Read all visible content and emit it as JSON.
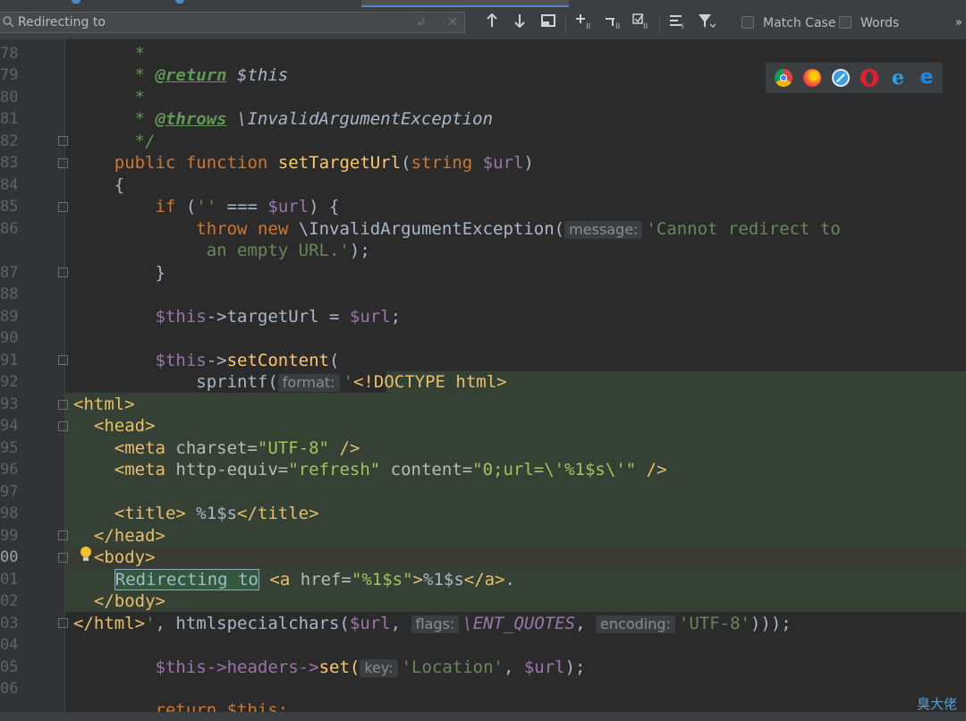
{
  "search": {
    "value": "Redirecting to",
    "match_case_label": "Match Case",
    "words_label": "Words"
  },
  "toolbar_icons": [
    "arrow-up-icon",
    "arrow-down-icon",
    "select-all-occurrences-icon",
    "add-occurrence-icon",
    "remove-occurrence-icon",
    "select-all-icon",
    "multiline-icon",
    "filter-icon",
    "more-icon"
  ],
  "browsers": [
    "chrome-icon",
    "firefox-icon",
    "safari-icon",
    "opera-icon",
    "ie-icon",
    "edge-icon"
  ],
  "line_numbers": [
    "78",
    "79",
    "80",
    "81",
    "82",
    "83",
    "84",
    "85",
    "86",
    "",
    "87",
    "88",
    "89",
    "90",
    "91",
    "92",
    "93",
    "94",
    "95",
    "96",
    "97",
    "98",
    "99",
    "00",
    "01",
    "02",
    "03",
    "04",
    "05",
    "06"
  ],
  "current_line": "00",
  "code": {
    "l79_tag": "@return",
    "l79_rest": " $this",
    "l81_tag": "@throws",
    "l81_rest": " \\InvalidArgumentException",
    "l83_public": "public",
    "l83_function": "function",
    "l83_name": "setTargetUrl",
    "l83_type": "string",
    "l83_var": "$url",
    "l85_if": "if",
    "l85_str": "''",
    "l85_op": " === ",
    "l85_var": "$url",
    "l86_throw": "throw",
    "l86_new": "new",
    "l86_class": " \\InvalidArgumentException(",
    "l86_hint": "message:",
    "l86_str1": "'Cannot redirect to",
    "l86b_str2": "an empty URL.'",
    "l86b_end": ");",
    "l89_this": "$this",
    "l89_prop": "->targetUrl = ",
    "l89_var": "$url",
    "l91_this": "$this",
    "l91_call": "setContent",
    "l92_fn": "sprintf(",
    "l92_hint": "format:",
    "l92_doctype": "<!DOCTYPE html>",
    "l93": "<html>",
    "l94": "<head>",
    "l95_meta": "<meta ",
    "l95_attr": "charset=",
    "l95_val": "\"UTF-8\"",
    "l95_end": " />",
    "l96_meta": "<meta ",
    "l96_attr1": "http-equiv=",
    "l96_val1": "\"refresh\"",
    "l96_attr2": " content=",
    "l96_val2": "\"0;url=\\'%1$s\\'\"",
    "l96_end": " />",
    "l98_open": "<title>",
    "l98_text": " %1$s",
    "l98_close": "</title>",
    "l99": "</head>",
    "l00": "<body>",
    "l01_match": "Redirecting to",
    "l01_a": "<a ",
    "l01_attr": "href=",
    "l01_val": "\"%1$s\"",
    "l01_gt": ">",
    "l01_text": "%1$s",
    "l01_close": "</a>",
    "l01_dot": ".",
    "l02": "</body>",
    "l03_html": "</html>",
    "l03_q": "'",
    "l03_mid": ", htmlspecialchars(",
    "l03_var": "$url",
    "l03_hint1": "flags:",
    "l03_const": "\\ENT_QUOTES",
    "l03_hint2": "encoding:",
    "l03_str": "'UTF-8'",
    "l03_end": ")));",
    "l05_this": "$this",
    "l05_mid": "->headers->",
    "l05_set": "set(",
    "l05_hint": "key:",
    "l05_str": "'Location'",
    "l05_var": "$url",
    "l05_end": ");",
    "l07": "return $this;"
  },
  "watermark": "臭大佬"
}
